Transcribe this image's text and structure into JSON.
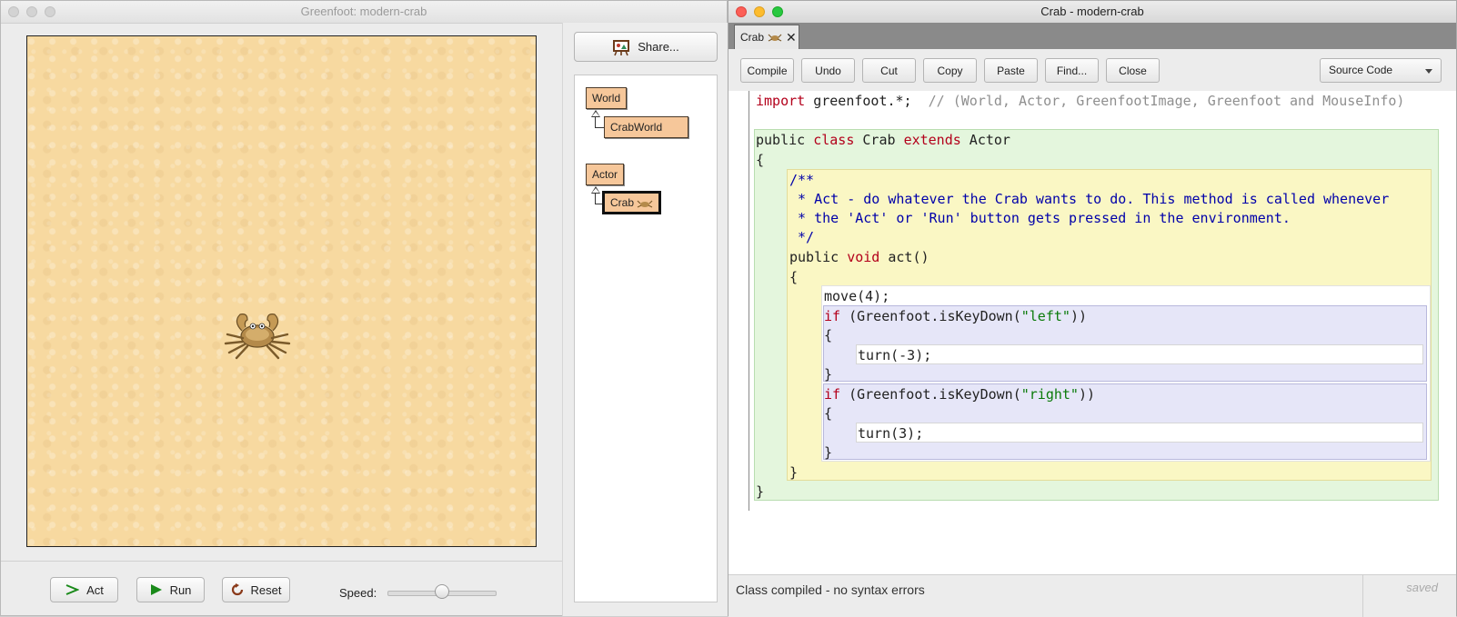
{
  "greenfoot": {
    "title": "Greenfoot: modern-crab",
    "share_label": "Share...",
    "classes": {
      "world": "World",
      "crabworld": "CrabWorld",
      "actor": "Actor",
      "crab": "Crab"
    },
    "controls": {
      "act_label": "Act",
      "run_label": "Run",
      "reset_label": "Reset",
      "speed_label": "Speed:",
      "speed_level": 0.5
    }
  },
  "editor": {
    "title": "Crab - modern-crab",
    "tab_label": "Crab",
    "toolbar": {
      "compile": "Compile",
      "undo": "Undo",
      "cut": "Cut",
      "copy": "Copy",
      "paste": "Paste",
      "find": "Find...",
      "close": "Close",
      "view_select": "Source Code"
    },
    "code": {
      "import_kw": "import",
      "import_rest": " greenfoot.*;  ",
      "import_comment": "// (World, Actor, GreenfootImage, Greenfoot and MouseInfo)",
      "class_public": "public",
      "class_kw": "class",
      "class_name": " Crab ",
      "class_extends": "extends",
      "class_super": " Actor",
      "brace_open": "{",
      "brace_close": "}",
      "jd1": "/**",
      "jd2": " * Act - do whatever the Crab wants to do. This method is called whenever",
      "jd3": " * the 'Act' or 'Run' button gets pressed in the environment.",
      "jd4": " */",
      "m_public": "public",
      "m_void": "void",
      "m_name": " act()",
      "stmt_move": "move(4);",
      "if_kw": "if",
      "if1_open": " (Greenfoot.isKeyDown(",
      "if1_str": "\"left\"",
      "if_close": "))",
      "turn1": "turn(-3);",
      "if2_str": "\"right\"",
      "turn2": "turn(3);"
    },
    "status": "Class compiled - no syntax errors",
    "saved": "saved"
  }
}
